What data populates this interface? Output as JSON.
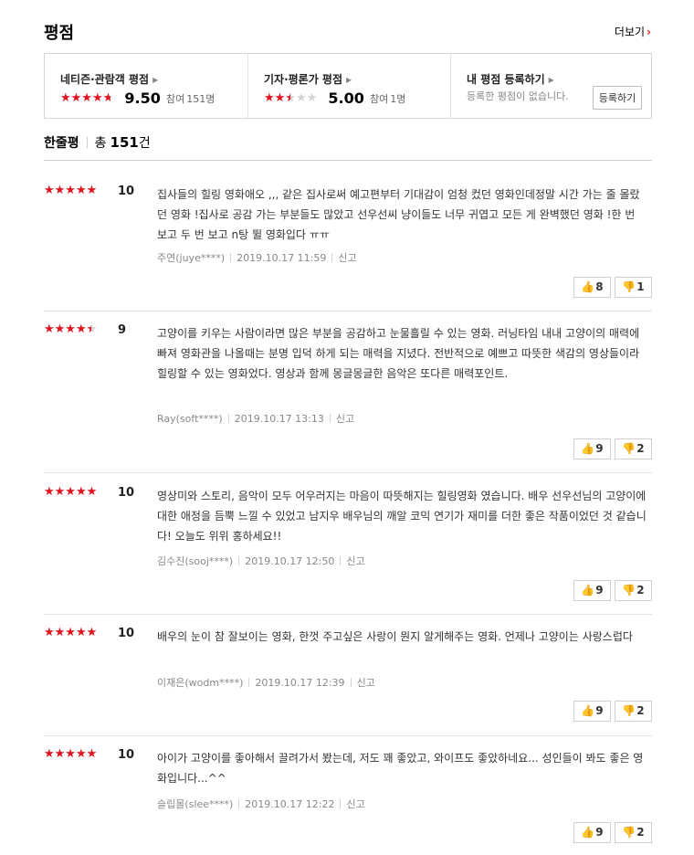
{
  "header": {
    "title": "평점",
    "more_label": "더보기"
  },
  "summary": {
    "netizen": {
      "title": "네티즌·관람객 평점",
      "score": "9.50",
      "participants_label": "참여",
      "participants": "151명",
      "rating_fraction": 0.95
    },
    "critic": {
      "title": "기자·평론가 평점",
      "score": "5.00",
      "participants_label": "참여",
      "participants": "1명",
      "rating_fraction": 0.5
    },
    "mine": {
      "title": "내 평점 등록하기",
      "empty_text": "등록한 평점이 없습니다.",
      "register_label": "등록하기"
    }
  },
  "list_header": {
    "label": "한줄평",
    "total_prefix": "총",
    "total_count": "151",
    "total_suffix": "건"
  },
  "vote_icons": {
    "up": "thumbs-up-icon",
    "down": "thumbs-down-icon"
  },
  "colors": {
    "star": "#e2131e",
    "accent": "#e2131e"
  },
  "reviews": [
    {
      "score": "10",
      "rating_fraction": 1.0,
      "text": "집사들의 힐링 영화애오 ,,, 같은 집사로써 예고편부터 기대감이 엄청 컸던 영화인데정말 시간 가는 줄 몰랐던 영화 !집사로 공감 가는 부분들도 많았고 선우선씨 냥이들도 너무 귀엽고 모든 게 완벽했던 영화 !한 번 보고 두 번 보고 n탕 뛸 영화입다 ㅠㅠ",
      "author": "주연(juye****)",
      "date": "2019.10.17 11:59",
      "report": "신고",
      "up": "8",
      "down": "1"
    },
    {
      "score": "9",
      "rating_fraction": 0.9,
      "text": "고양이를 키우는 사람이라면 많은 부분을 공감하고 눈물흘릴 수 있는 영화. 러닝타임 내내 고양이의 매력에 빠져 영화관을 나올때는 분명 입덕 하게 되는 매력을 지녔다. 전반적으로 예쁘고 따뜻한 색감의 영상들이라 힐링할 수 있는 영화었다. 영상과 함께 몽글몽글한 음악은 또다른 매력포인트.",
      "author": "Ray(soft****)",
      "date": "2019.10.17 13:13",
      "report": "신고",
      "up": "9",
      "down": "2"
    },
    {
      "score": "10",
      "rating_fraction": 1.0,
      "text": "영상미와 스토리, 음악이 모두 어우러지는 마음이 따뜻해지는 힐링영화 였습니다. 배우 선우선님의 고양이에 대한 애정을 듬뿍 느낄 수 있었고 남지우 배우님의 깨알 코믹 연기가 재미를 더한 좋은 작품이었던 것 같습니다! 오늘도 위위 홍하세요!!",
      "author": "김수진(sooj****)",
      "date": "2019.10.17 12:50",
      "report": "신고",
      "up": "9",
      "down": "2"
    },
    {
      "score": "10",
      "rating_fraction": 1.0,
      "text": "배우의 눈이 참 잘보이는 영화, 한껏 주고싶은 사랑이 뭔지 알게해주는 영화. 언제나 고양이는 사랑스럽다",
      "author": "이재은(wodm****)",
      "date": "2019.10.17 12:39",
      "report": "신고",
      "up": "9",
      "down": "2"
    },
    {
      "score": "10",
      "rating_fraction": 1.0,
      "text": "아이가 고양이를 좋아해서 끌려가서 봤는데, 저도 꽤 좋았고, 와이프도 좋았하네요... 성인들이 봐도 좋은 영화입니다...^^",
      "author": "슬립몰(slee****)",
      "date": "2019.10.17 12:22",
      "report": "신고",
      "up": "9",
      "down": "2"
    }
  ]
}
